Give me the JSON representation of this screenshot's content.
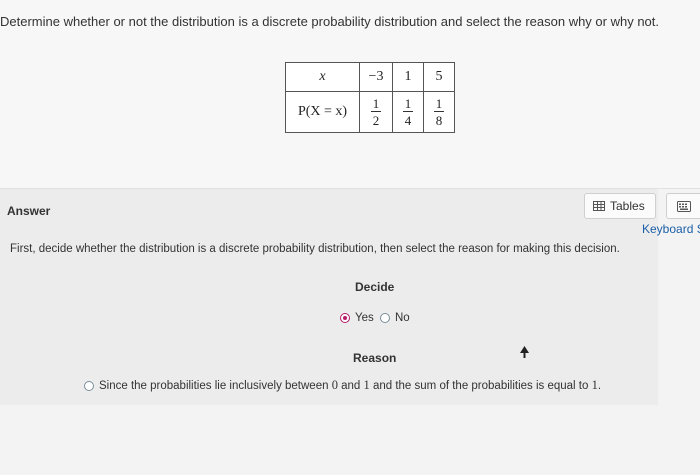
{
  "question": {
    "text": "Determine whether or not the distribution is a discrete probability distribution and select the reason why or why not."
  },
  "distribution_table": {
    "x_header": "x",
    "p_header": "P(X = x)",
    "x_values": [
      "−3",
      "1",
      "5"
    ],
    "probabilities": [
      {
        "num": "1",
        "den": "2"
      },
      {
        "num": "1",
        "den": "4"
      },
      {
        "num": "1",
        "den": "8"
      }
    ]
  },
  "answer": {
    "label": "Answer",
    "tables_button": "Tables",
    "keyboard_link": "Keyboard S",
    "instruction": "First, decide whether the distribution is a discrete probability distribution, then select the reason for making this decision.",
    "decide_label": "Decide",
    "options": [
      {
        "label": "Yes",
        "selected": true
      },
      {
        "label": "No",
        "selected": false
      }
    ],
    "reason_label": "Reason",
    "reason_option": {
      "text_before": "Since the probabilities lie inclusively between ",
      "zero": "0",
      "text_middle": " and ",
      "one_a": "1",
      "text_after": " and the sum of the probabilities is equal to ",
      "one_b": "1",
      "end": "."
    }
  },
  "colors": {
    "selected_radio": "#b81c6b",
    "link": "#1b5fa8"
  }
}
